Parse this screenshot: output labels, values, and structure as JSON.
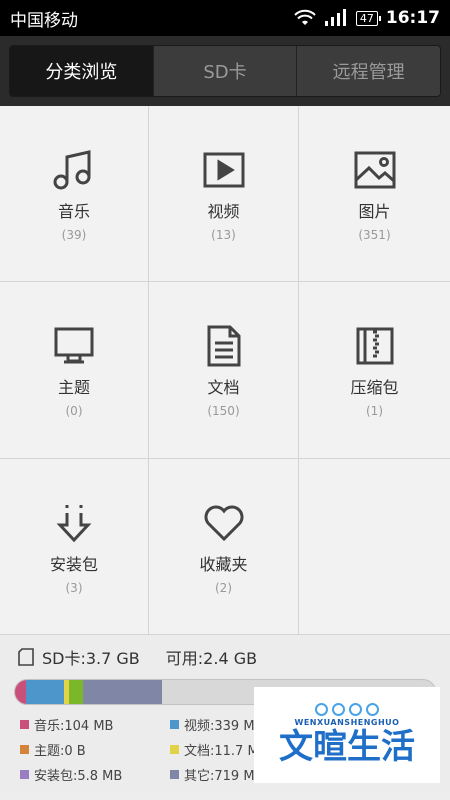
{
  "status_bar": {
    "carrier": "中国移动",
    "battery": "47",
    "time": "16:17"
  },
  "tabs": [
    {
      "label": "分类浏览",
      "active": true
    },
    {
      "label": "SD卡",
      "active": false
    },
    {
      "label": "远程管理",
      "active": false
    }
  ],
  "categories": [
    {
      "label": "音乐",
      "count": "(39)",
      "icon": "music-icon"
    },
    {
      "label": "视频",
      "count": "(13)",
      "icon": "video-icon"
    },
    {
      "label": "图片",
      "count": "(351)",
      "icon": "image-icon"
    },
    {
      "label": "主题",
      "count": "(0)",
      "icon": "theme-icon"
    },
    {
      "label": "文档",
      "count": "(150)",
      "icon": "document-icon"
    },
    {
      "label": "压缩包",
      "count": "(1)",
      "icon": "archive-icon"
    },
    {
      "label": "安装包",
      "count": "(3)",
      "icon": "install-icon"
    },
    {
      "label": "收藏夹",
      "count": "(2)",
      "icon": "heart-icon"
    }
  ],
  "storage": {
    "sd_label": "SD卡:3.7 GB",
    "free_label": "可用:2.4 GB",
    "colors": {
      "music": "#c9507a",
      "video": "#4d96cc",
      "theme": "#d4843a",
      "document": "#e2d248",
      "install": "#9a7ec0",
      "other": "#7f86a6"
    },
    "legend": [
      {
        "key": "music",
        "text": "音乐:104 MB"
      },
      {
        "key": "video",
        "text": "视频:339 MB"
      },
      {
        "key": "theme",
        "text": "主题:0 B"
      },
      {
        "key": "document",
        "text": "文档:11.7 MB"
      },
      {
        "key": "install",
        "text": "安装包:5.8 MB"
      },
      {
        "key": "other",
        "text": "其它:719 MB"
      }
    ]
  },
  "watermark": {
    "sub": "WENXUANSHENGHUO",
    "main": "文暄生活"
  }
}
